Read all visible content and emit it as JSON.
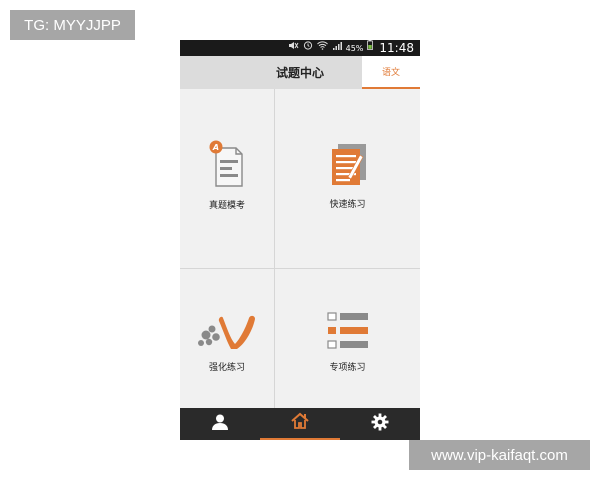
{
  "watermarks": {
    "top": "TG: MYYJJPP",
    "bottom": "www.vip-kaifaqt.com"
  },
  "status_bar": {
    "icons": [
      "mute-icon",
      "alarm-icon",
      "wifi-icon",
      "signal-icon",
      "battery-icon"
    ],
    "battery_percent": "45%",
    "time": "11:48"
  },
  "header": {
    "title": "试题中心",
    "subject_tab": "语文"
  },
  "grid": {
    "items": [
      {
        "label": "真题模考",
        "icon": "mock-exam-icon",
        "badge": "A"
      },
      {
        "label": "快速练习",
        "icon": "quick-practice-icon"
      },
      {
        "label": "强化练习",
        "icon": "intensive-practice-icon"
      },
      {
        "label": "专项练习",
        "icon": "special-practice-icon"
      }
    ]
  },
  "nav": {
    "items": [
      {
        "icon": "user-icon",
        "active": false
      },
      {
        "icon": "home-icon",
        "active": true
      },
      {
        "icon": "gear-icon",
        "active": false
      }
    ]
  },
  "colors": {
    "accent": "#e07a36",
    "status_bar": "#1a1a1a",
    "title_bar": "#dcdcdc",
    "nav_bar": "#2a2a2a",
    "icon_gray": "#7a7a7a"
  }
}
